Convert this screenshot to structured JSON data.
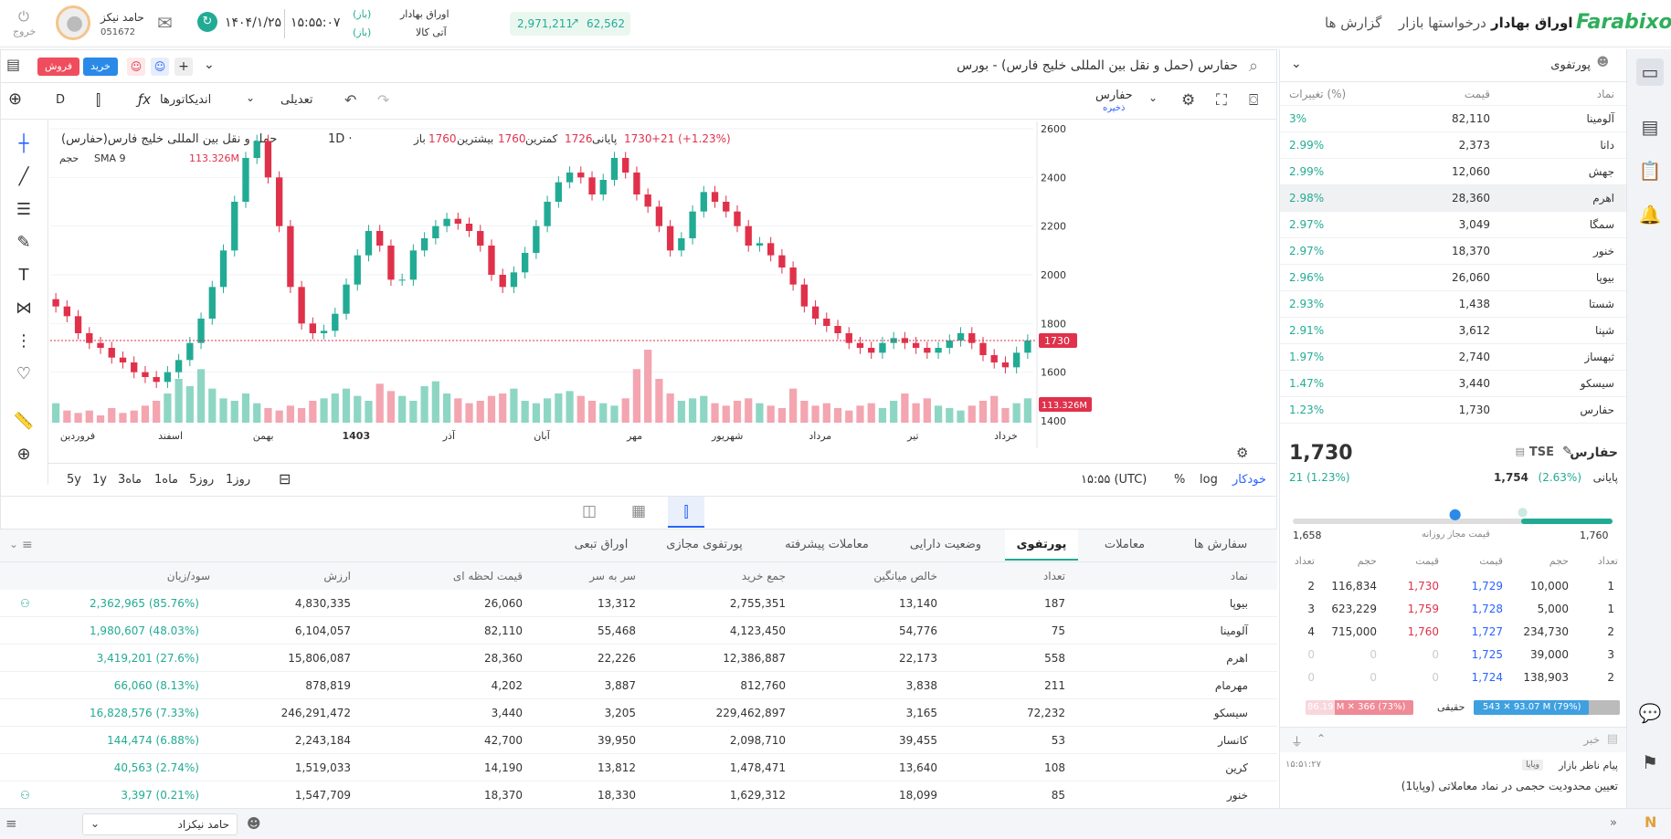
{
  "header": {
    "logo": "Farabixo",
    "nav": [
      "اوراق بهادار",
      "درخواستها بازار",
      "گزارش ها"
    ],
    "index1": {
      "name": "اوراق بهادار",
      "status": "(باز)"
    },
    "index2": {
      "name": "آتی کالا",
      "status": "(باز)"
    },
    "time": "۱۵:۵۵:۰۷",
    "date": "۱۴۰۴/۱/۲۵",
    "user_name": "حامد نیکز",
    "user_code": "051672",
    "logout": "خروج",
    "ticker_value": "62,562",
    "ticker_value2": "2,971,211"
  },
  "symbol_bar": {
    "title": "حفارس (حمل و نقل بین المللی خلیج فارس) - بورس",
    "buy": "خرید",
    "sell": "فروش"
  },
  "chart_toolbar": {
    "symbol": "حفارس",
    "save": "ذخیره",
    "adjust": "تعدیلی",
    "indicators": "اندیکاتورها",
    "interval": "D"
  },
  "chart_legend": {
    "title": "حمل و نقل بین المللی خلیج فارس(حفارس)",
    "interval": "1D ·",
    "open_label": "باز",
    "open": "1760",
    "high_label": "بیشترین",
    "high": "1760",
    "low_label": "کمترین",
    "low": "1726",
    "close_label": "پایانی",
    "close": "1730",
    "change": "+21 (+1.23%)",
    "volume_label": "حجم",
    "sma_label": "SMA 9",
    "volume": "113.326M"
  },
  "chart_footer": {
    "ranges": [
      "5y",
      "1y",
      "3ماه",
      "1ماه",
      "5روز",
      "1روز"
    ],
    "time": "۱۵:۵۵ (UTC)",
    "pct": "%",
    "log": "log",
    "auto": "خودکار"
  },
  "chart_data": {
    "type": "candlestick",
    "y_ticks": [
      "2600",
      "2400",
      "2200",
      "2000",
      "1800",
      "1600",
      "1400"
    ],
    "ylim": [
      1400,
      2600
    ],
    "x_ticks": [
      "خرداد",
      "تیر",
      "مرداد",
      "شهریور",
      "مهر",
      "آبان",
      "آذر",
      "1403",
      "بهمن",
      "اسفند",
      "فروردین"
    ],
    "last_price_label": "1730",
    "last_volume_label": "113.326M",
    "closes": [
      1870,
      1830,
      1760,
      1720,
      1700,
      1660,
      1640,
      1600,
      1580,
      1560,
      1600,
      1650,
      1720,
      1820,
      1950,
      2100,
      2300,
      2480,
      2550,
      2400,
      2200,
      1950,
      1800,
      1760,
      1770,
      1840,
      1960,
      2080,
      2180,
      2120,
      1980,
      1980,
      2100,
      2150,
      2200,
      2230,
      2210,
      2180,
      2120,
      2000,
      1950,
      2010,
      2090,
      2200,
      2300,
      2380,
      2420,
      2400,
      2330,
      2390,
      2480,
      2420,
      2330,
      2280,
      2200,
      2100,
      2150,
      2260,
      2340,
      2300,
      2260,
      2200,
      2120,
      2130,
      2080,
      2030,
      1960,
      1870,
      1820,
      1790,
      1760,
      1720,
      1700,
      1680,
      1720,
      1740,
      1720,
      1700,
      1680,
      1700,
      1730,
      1760,
      1720,
      1670,
      1640,
      1620,
      1680,
      1730
    ],
    "volumes": [
      8,
      5,
      4,
      5,
      3,
      6,
      4,
      5,
      7,
      9,
      12,
      18,
      15,
      22,
      14,
      10,
      9,
      12,
      8,
      6,
      5,
      7,
      6,
      9,
      10,
      12,
      14,
      11,
      9,
      16,
      13,
      11,
      9,
      15,
      17,
      12,
      10,
      8,
      9,
      11,
      12,
      14,
      9,
      8,
      10,
      12,
      13,
      11,
      9,
      8,
      7,
      10,
      22,
      30,
      18,
      12,
      9,
      10,
      11,
      8,
      7,
      9,
      10,
      8,
      7,
      6,
      14,
      9,
      7,
      8,
      6,
      5,
      7,
      8,
      6,
      9,
      12,
      8,
      10,
      7,
      6,
      5,
      7,
      9,
      11,
      6,
      8,
      10
    ]
  },
  "bottom_tabs": [
    "سفارش ها",
    "معاملات",
    "پورتفوی",
    "وضعیت دارایی",
    "معاملات پیشرفته",
    "پورتفوی مجازی",
    "اوراق تبعی"
  ],
  "portfolio": {
    "headers": [
      "نماد",
      "تعداد",
      "خالص میانگین",
      "جمع خرید",
      "سر به سر",
      "قیمت لحظه ای",
      "ارزش",
      "سود/زیان"
    ],
    "rows": [
      [
        "بیوپا",
        "187",
        "13,140",
        "2,755,351",
        "13,312",
        "26,060",
        "4,830,335",
        "2,362,965 (85.76%)"
      ],
      [
        "آلومینا",
        "75",
        "54,776",
        "4,123,450",
        "55,468",
        "82,110",
        "6,104,057",
        "1,980,607 (48.03%)"
      ],
      [
        "اهرم",
        "558",
        "22,173",
        "12,386,887",
        "22,226",
        "28,360",
        "15,806,087",
        "3,419,201 (27.6%)"
      ],
      [
        "مهرمام",
        "211",
        "3,838",
        "812,760",
        "3,887",
        "4,202",
        "878,819",
        "66,060 (8.13%)"
      ],
      [
        "سیسکو",
        "72,232",
        "3,165",
        "229,462,897",
        "3,205",
        "3,440",
        "246,291,472",
        "16,828,576 (7.33%)"
      ],
      [
        "کانسار",
        "53",
        "39,455",
        "2,098,710",
        "39,950",
        "42,700",
        "2,243,184",
        "144,474 (6.88%)"
      ],
      [
        "کرین",
        "108",
        "13,640",
        "1,478,471",
        "13,812",
        "14,190",
        "1,519,033",
        "40,563 (2.74%)"
      ],
      [
        "خنور",
        "85",
        "18,099",
        "1,629,312",
        "18,330",
        "18,370",
        "1,547,709",
        "3,397 (0.21%)"
      ]
    ]
  },
  "watchlist": {
    "title": "پورتفوی",
    "headers": [
      "نماد",
      "قیمت",
      "تغییرات (%)"
    ],
    "rows": [
      [
        "آلومینا",
        "82,110",
        "3%"
      ],
      [
        "دانا",
        "2,373",
        "2.99%"
      ],
      [
        "جهش",
        "12,060",
        "2.99%"
      ],
      [
        "اهرم",
        "28,360",
        "2.98%"
      ],
      [
        "سمگا",
        "3,049",
        "2.97%"
      ],
      [
        "خنور",
        "18,370",
        "2.97%"
      ],
      [
        "بیوپا",
        "26,060",
        "2.96%"
      ],
      [
        "شستا",
        "1,438",
        "2.93%"
      ],
      [
        "شپنا",
        "3,612",
        "2.91%"
      ],
      [
        "ثبهساز",
        "2,740",
        "1.97%"
      ],
      [
        "سیسکو",
        "3,440",
        "1.47%"
      ],
      [
        "حفارس",
        "1,730",
        "1.23%"
      ]
    ]
  },
  "quote": {
    "symbol": "حفارس",
    "market": "TSE",
    "last": "1,730",
    "last_change": "21 (1.23%)",
    "close_label": "پایانی",
    "close": "1,754",
    "close_change": "(2.63%)",
    "range_low": "1,658",
    "range_high": "1,760",
    "range_label": "قیمت مجاز روزانه"
  },
  "orderbook": {
    "headers": [
      "تعداد",
      "حجم",
      "قیمت",
      "قیمت",
      "حجم",
      "تعداد"
    ],
    "rows": [
      [
        "1",
        "10,000",
        "1,729",
        "1,730",
        "116,834",
        "2"
      ],
      [
        "1",
        "5,000",
        "1,728",
        "1,759",
        "623,229",
        "3"
      ],
      [
        "2",
        "234,730",
        "1,727",
        "1,760",
        "715,000",
        "4"
      ],
      [
        "3",
        "39,000",
        "1,725",
        "0",
        "0",
        "0"
      ],
      [
        "2",
        "138,903",
        "1,724",
        "0",
        "0",
        "0"
      ]
    ],
    "buyer_bar": "543 ✕ 93.07 M (79%)",
    "seller_bar": "86.19 M ✕ 366 (73%)",
    "buyer_pct": 0.79,
    "seller_pct": 0.73,
    "type_label": "حقیقی"
  },
  "news": {
    "title": "خبر",
    "source": "پیام ناظر بازار",
    "tag": "وپایا",
    "time": "۱۵:۵۱:۲۷",
    "text": "تعیین محدودیت حجمی در نماد معاملاتی (وپایا1)"
  },
  "statusbar": {
    "user": "حامد نیکزاد"
  }
}
